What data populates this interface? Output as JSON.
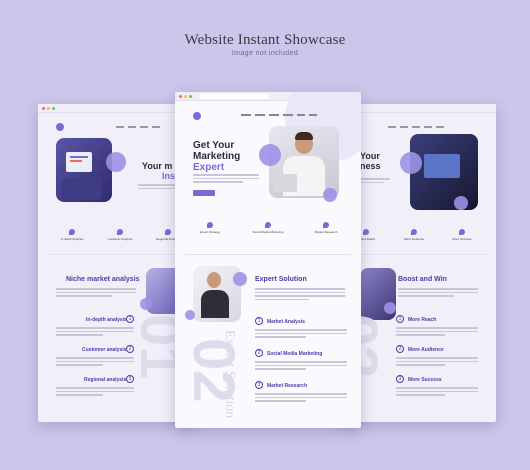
{
  "header": {
    "title": "Website Instant Showcase",
    "subtitle": "Image not included"
  },
  "center": {
    "hero_line1": "Get Your",
    "hero_line2": "Marketing",
    "hero_line3": "Expert",
    "features": [
      "Expert Strategy",
      "Social Media Marketing",
      "Market Research"
    ],
    "section_title": "Expert Solution",
    "items": [
      {
        "num": "1",
        "title": "Market Analysis"
      },
      {
        "num": "2",
        "title": "Social Media Marketing"
      },
      {
        "num": "3",
        "title": "Market Research"
      }
    ],
    "big_number": "02",
    "vertical_text": "Expert Solution"
  },
  "left": {
    "hero_line1": "Your m",
    "hero_line2": "Ins",
    "features": [
      "In-depth Analysis",
      "Customer Analysis",
      "Regional Analysis"
    ],
    "section_title": "Niche market analysis",
    "items": [
      {
        "num": "1",
        "title": "In-depth analysis"
      },
      {
        "num": "2",
        "title": "Customer analysis"
      },
      {
        "num": "3",
        "title": "Regional analysis"
      }
    ],
    "big_number": "01"
  },
  "right": {
    "hero_line1": "Your",
    "hero_line2": "ness",
    "features": [
      "Market Reach",
      "More Audience",
      "More Success"
    ],
    "section_title": "Boost and Win",
    "items": [
      {
        "num": "1",
        "title": "More Reach"
      },
      {
        "num": "2",
        "title": "More Audience"
      },
      {
        "num": "3",
        "title": "More Success"
      }
    ],
    "big_number": "03"
  },
  "colors": {
    "background": "#cdc6ea",
    "accent": "#7b6ad6",
    "heading": "#4b3ea8"
  },
  "icons": [
    "browser-dot-icon",
    "logo-icon",
    "feature-icon",
    "number-circle-icon"
  ]
}
